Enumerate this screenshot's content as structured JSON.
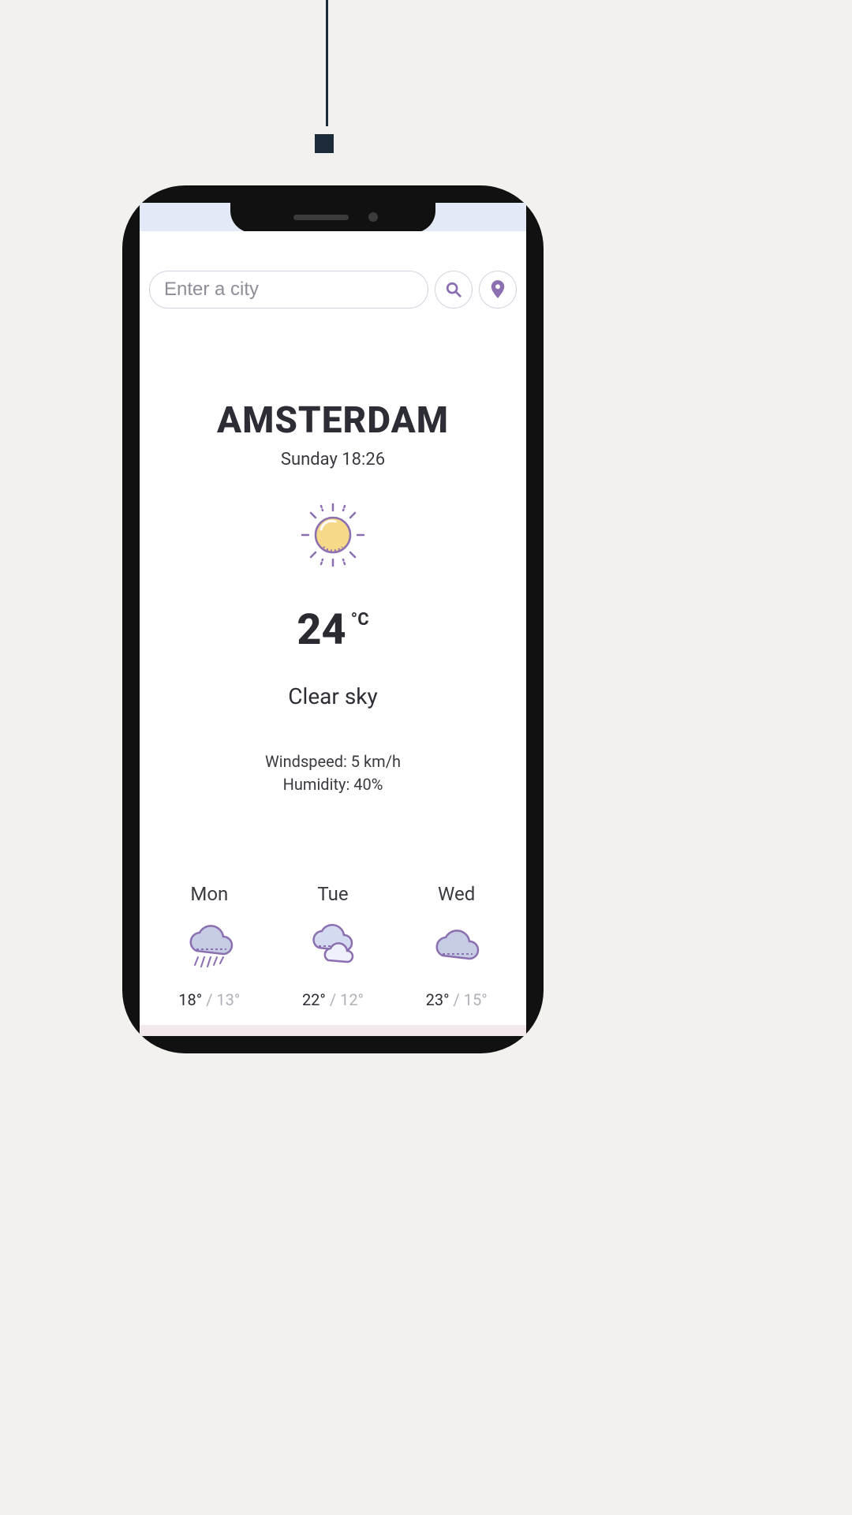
{
  "search": {
    "placeholder": "Enter a city"
  },
  "city": "AMSTERDAM",
  "datetime": "Sunday 18:26",
  "temperature": "24",
  "unit": "°C",
  "condition": "Clear sky",
  "windspeed": "Windspeed: 5 km/h",
  "humidity": "Humidity: 40%",
  "icons": {
    "current": "sun-icon",
    "search": "search-icon",
    "location": "location-icon"
  },
  "forecast": [
    {
      "day": "Mon",
      "icon": "rain-cloud-icon",
      "hi": "18°",
      "lo": "13°"
    },
    {
      "day": "Tue",
      "icon": "partly-cloudy-icon",
      "hi": "22°",
      "lo": "12°"
    },
    {
      "day": "Wed",
      "icon": "cloud-icon",
      "hi": "23°",
      "lo": "15°"
    }
  ],
  "colors": {
    "accent": "#8b6fb0",
    "iconFill": "#c7cce5",
    "sunFill": "#f7d98a",
    "cloudFill": "#d4daf0"
  }
}
